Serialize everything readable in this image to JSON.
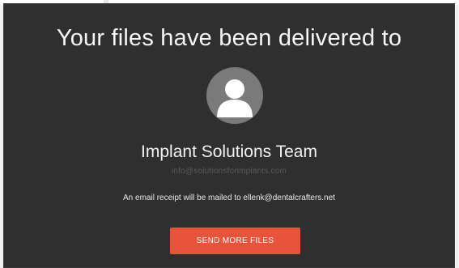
{
  "header": {
    "title": "Your files have been delivered to"
  },
  "recipient": {
    "avatar_icon": "user-silhouette-icon",
    "name": "Implant Solutions Team",
    "email": "info@solutionsforimplants.com"
  },
  "receipt": {
    "note": "An email receipt will be mailed to ellenk@dentalcrafters.net"
  },
  "actions": {
    "send_more_label": "SEND MORE FILES"
  },
  "colors": {
    "panel_background": "#2f2f2f",
    "avatar_background": "#7a7a7a",
    "button_background": "#e8533a",
    "text_primary": "#ffffff"
  }
}
